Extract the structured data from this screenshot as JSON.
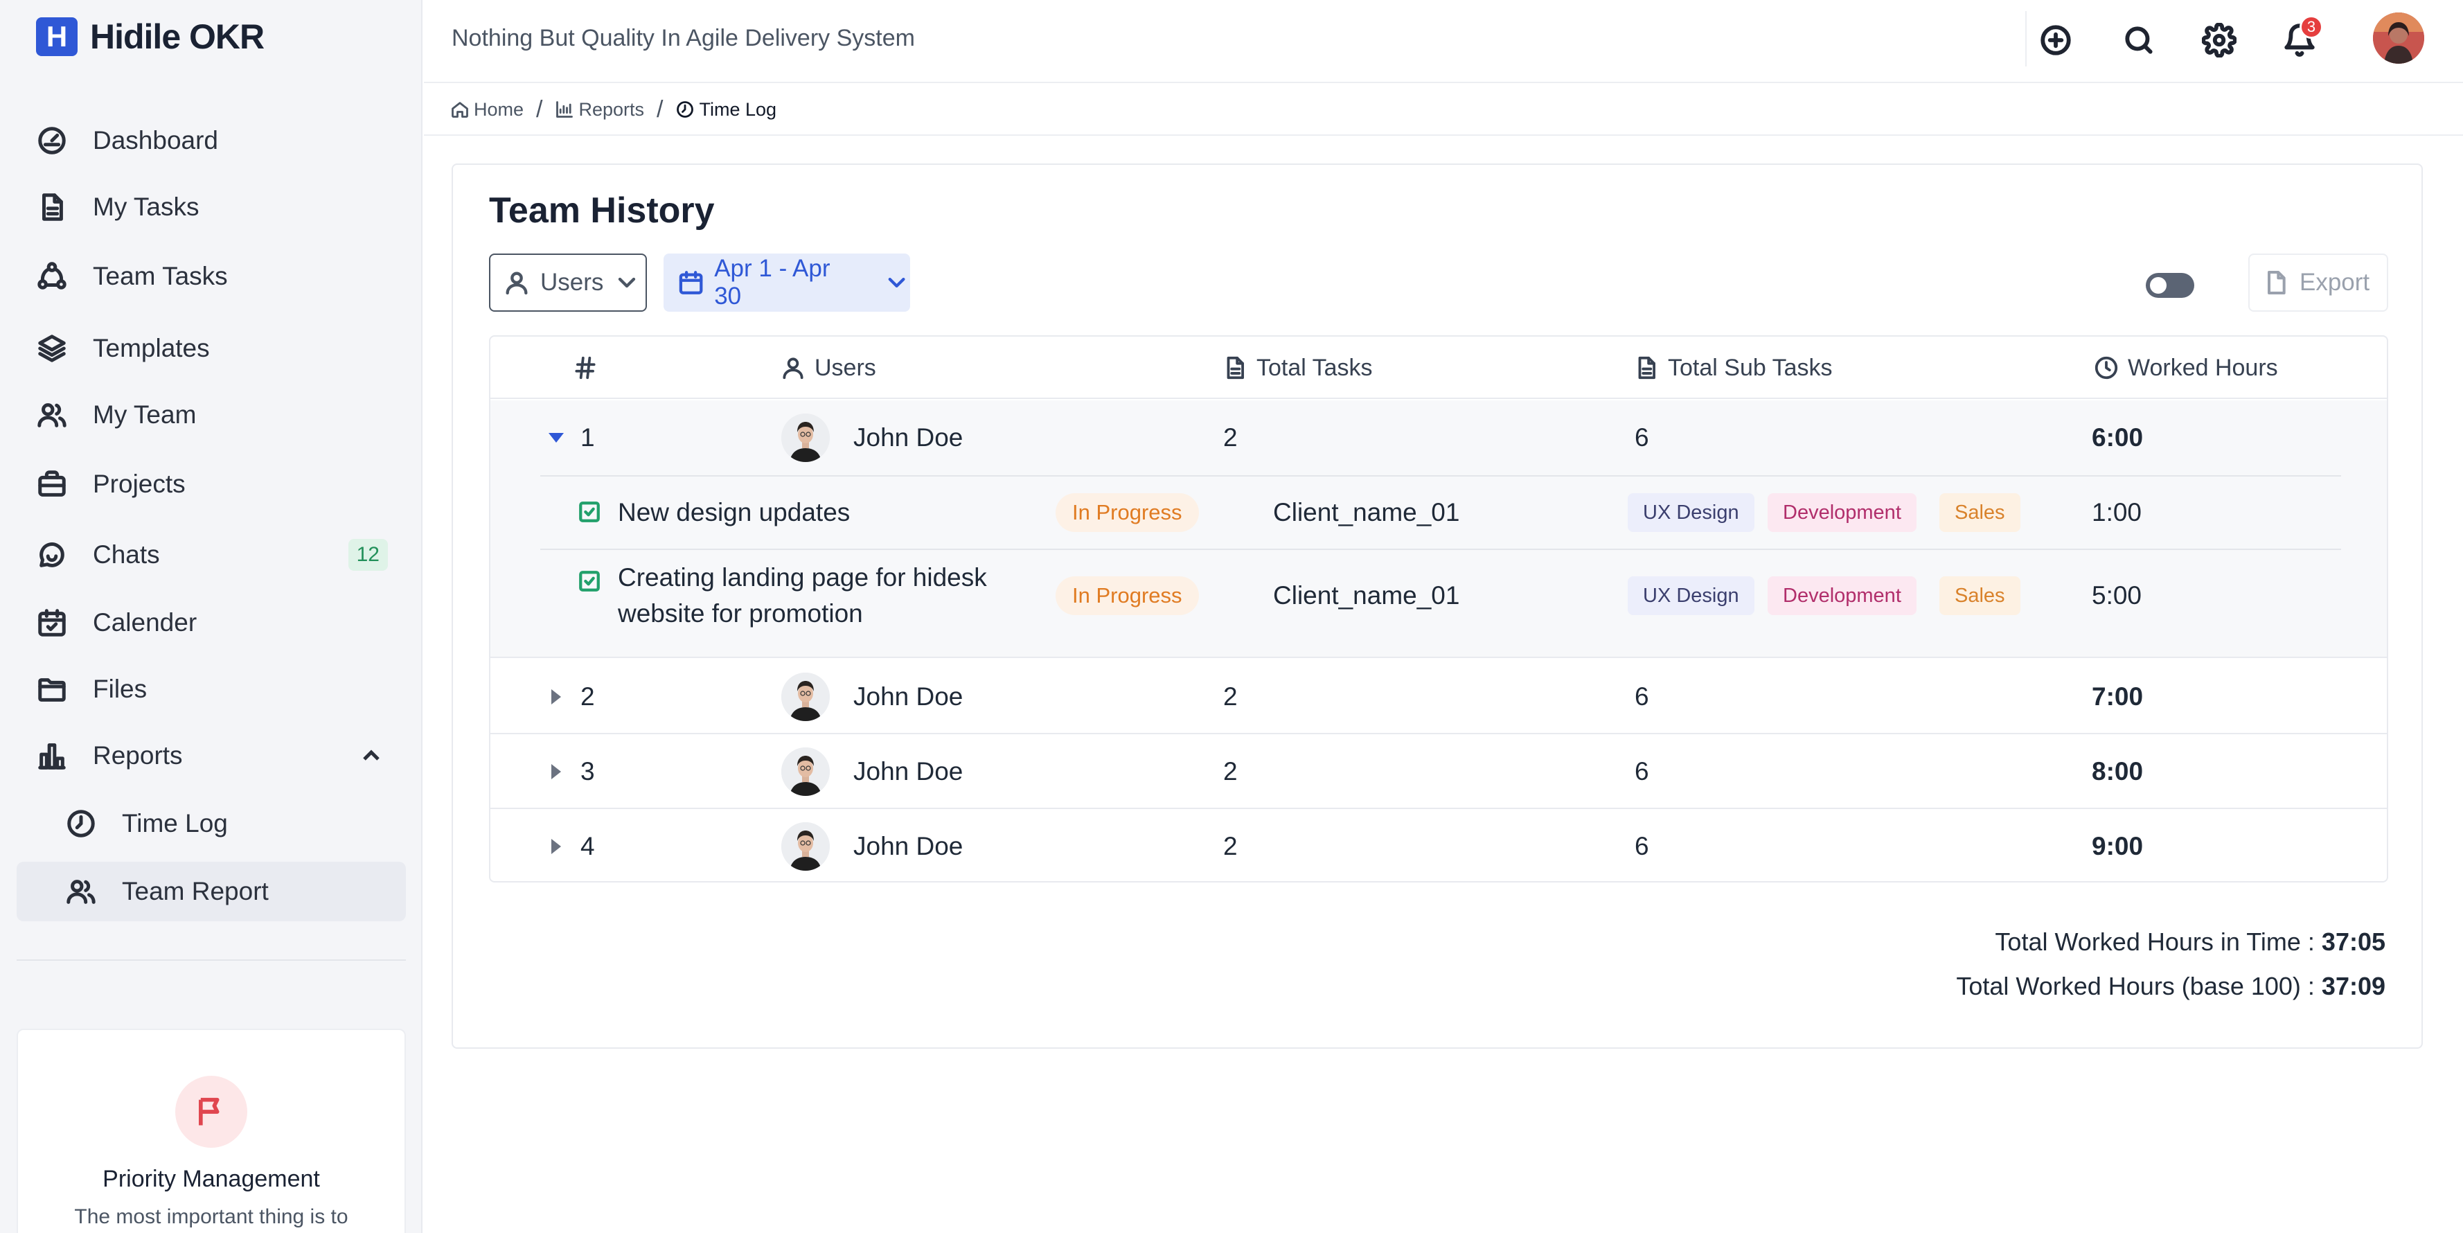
{
  "app": {
    "logo_letter": "H",
    "name": "Hidile OKR",
    "tagline": "Nothing But Quality In Agile Delivery System"
  },
  "sidebar": {
    "items": [
      {
        "label": "Dashboard",
        "icon": "dashboard-icon"
      },
      {
        "label": "My Tasks",
        "icon": "document-icon"
      },
      {
        "label": "Team Tasks",
        "icon": "team-tasks-icon"
      },
      {
        "label": "Templates",
        "icon": "layers-icon"
      },
      {
        "label": "My Team",
        "icon": "team-icon"
      },
      {
        "label": "Projects",
        "icon": "briefcase-icon"
      },
      {
        "label": "Chats",
        "icon": "chat-icon",
        "badge": "12"
      },
      {
        "label": "Calender",
        "icon": "calendar-icon"
      },
      {
        "label": "Files",
        "icon": "folder-icon"
      },
      {
        "label": "Reports",
        "icon": "reports-icon",
        "expanded": true
      }
    ],
    "sub_items": [
      {
        "label": "Time Log",
        "icon": "clock-icon"
      },
      {
        "label": "Team Report",
        "icon": "team-icon",
        "active": true
      }
    ],
    "promo": {
      "title": "Priority Management",
      "text": "The most important thing is to"
    }
  },
  "topbar": {
    "notification_count": "3"
  },
  "breadcrumb": [
    {
      "label": "Home",
      "icon": "home-icon"
    },
    {
      "label": "Reports",
      "icon": "chart-icon"
    },
    {
      "label": "Time Log",
      "icon": "clock-icon"
    }
  ],
  "page": {
    "title": "Team History",
    "filters": {
      "users_label": "Users",
      "date_range": "Apr 1 - Apr 30"
    },
    "export_label": "Export"
  },
  "table": {
    "columns": [
      {
        "label": "#",
        "icon": "hash-icon"
      },
      {
        "label": "Users",
        "icon": "user-icon"
      },
      {
        "label": "Total Tasks",
        "icon": "document-icon"
      },
      {
        "label": "Total Sub Tasks",
        "icon": "document-icon"
      },
      {
        "label": "Worked Hours",
        "icon": "clock-icon"
      }
    ],
    "rows": [
      {
        "index": "1",
        "user": "John Doe",
        "total_tasks": "2",
        "total_sub_tasks": "6",
        "worked_hours": "6:00",
        "expanded": true,
        "tasks": [
          {
            "title": "New design updates",
            "status": "In Progress",
            "client": "Client_name_01",
            "tags": [
              "UX Design",
              "Development",
              "Sales"
            ],
            "hours": "1:00"
          },
          {
            "title_line1": "Creating landing page for hidesk",
            "title_line2": "website for promotion",
            "status": "In Progress",
            "client": "Client_name_01",
            "tags": [
              "UX Design",
              "Development",
              "Sales"
            ],
            "hours": "5:00"
          }
        ]
      },
      {
        "index": "2",
        "user": "John Doe",
        "total_tasks": "2",
        "total_sub_tasks": "6",
        "worked_hours": "7:00"
      },
      {
        "index": "3",
        "user": "John Doe",
        "total_tasks": "2",
        "total_sub_tasks": "6",
        "worked_hours": "8:00"
      },
      {
        "index": "4",
        "user": "John Doe",
        "total_tasks": "2",
        "total_sub_tasks": "6",
        "worked_hours": "9:00"
      }
    ]
  },
  "totals": {
    "label_time": "Total Worked Hours in Time : ",
    "value_time": "37:05",
    "label_base": "Total Worked Hours (base 100) : ",
    "value_base": "37:09"
  },
  "colors": {
    "accent": "#2f58d6",
    "status_in_progress": "#e07b22",
    "success": "#22a06b",
    "danger": "#e53e3e"
  }
}
